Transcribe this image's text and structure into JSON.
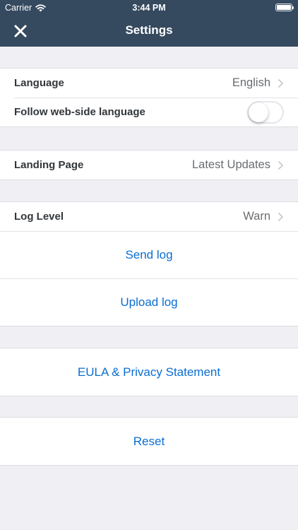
{
  "statusbar": {
    "carrier": "Carrier",
    "time": "3:44 PM"
  },
  "navbar": {
    "title": "Settings"
  },
  "language": {
    "label": "Language",
    "value": "English"
  },
  "follow_web": {
    "label": "Follow web-side language",
    "enabled": false
  },
  "landing": {
    "label": "Landing Page",
    "value": "Latest Updates"
  },
  "log": {
    "label": "Log Level",
    "value": "Warn",
    "send_label": "Send log",
    "upload_label": "Upload log"
  },
  "eula": {
    "label": "EULA & Privacy Statement"
  },
  "reset": {
    "label": "Reset"
  },
  "colors": {
    "header": "#354a5f",
    "link": "#0a6ed1",
    "background": "#efeff4"
  }
}
